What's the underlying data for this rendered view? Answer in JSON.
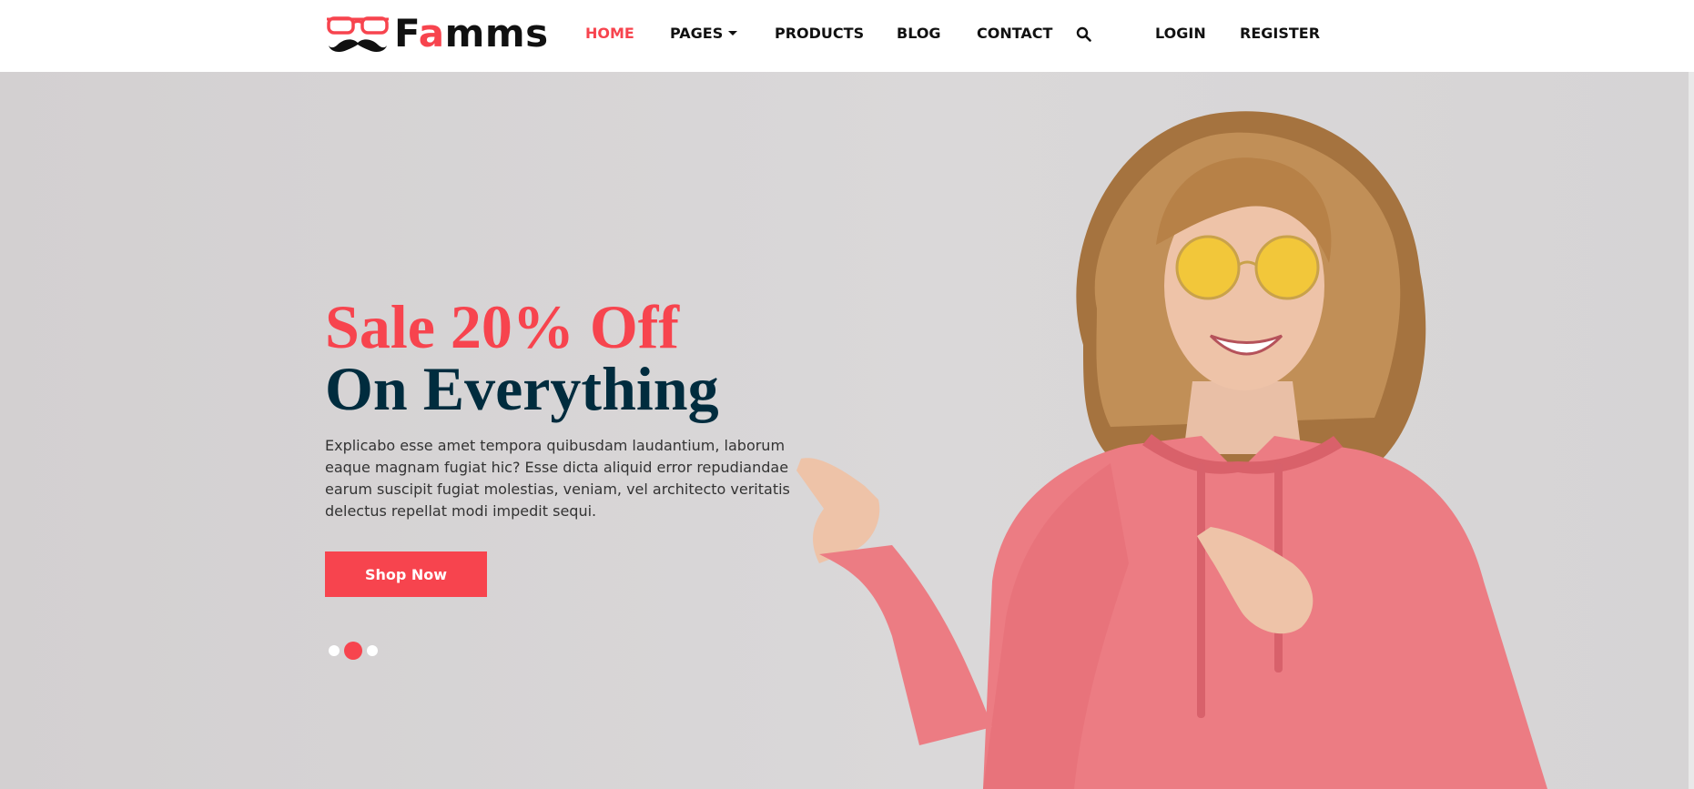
{
  "brand": {
    "logo_prefix": "F",
    "logo_accent": "a",
    "logo_rest": "mms",
    "accent_color": "#f7444e",
    "dark_color": "#002c3e"
  },
  "nav": {
    "home": "HOME",
    "pages": "PAGES",
    "products": "PRODUCTS",
    "blog": "BLOG",
    "contact": "CONTACT",
    "login": "LOGIN",
    "register": "REGISTER",
    "search_icon": "search-icon",
    "active_item": "HOME"
  },
  "hero": {
    "title_line1": "Sale 20% Off",
    "title_line2": "On Everything",
    "description": "Explicabo esse amet tempora quibusdam laudantium, laborum eaque magnam fugiat hic? Esse dicta aliquid error repudiandae earum suscipit fugiat molestias, veniam, vel architecto veritatis delectus repellat modi impedit sequi.",
    "button_label": "Shop Now",
    "carousel": {
      "slide_count": 3,
      "active_index": 1
    }
  }
}
